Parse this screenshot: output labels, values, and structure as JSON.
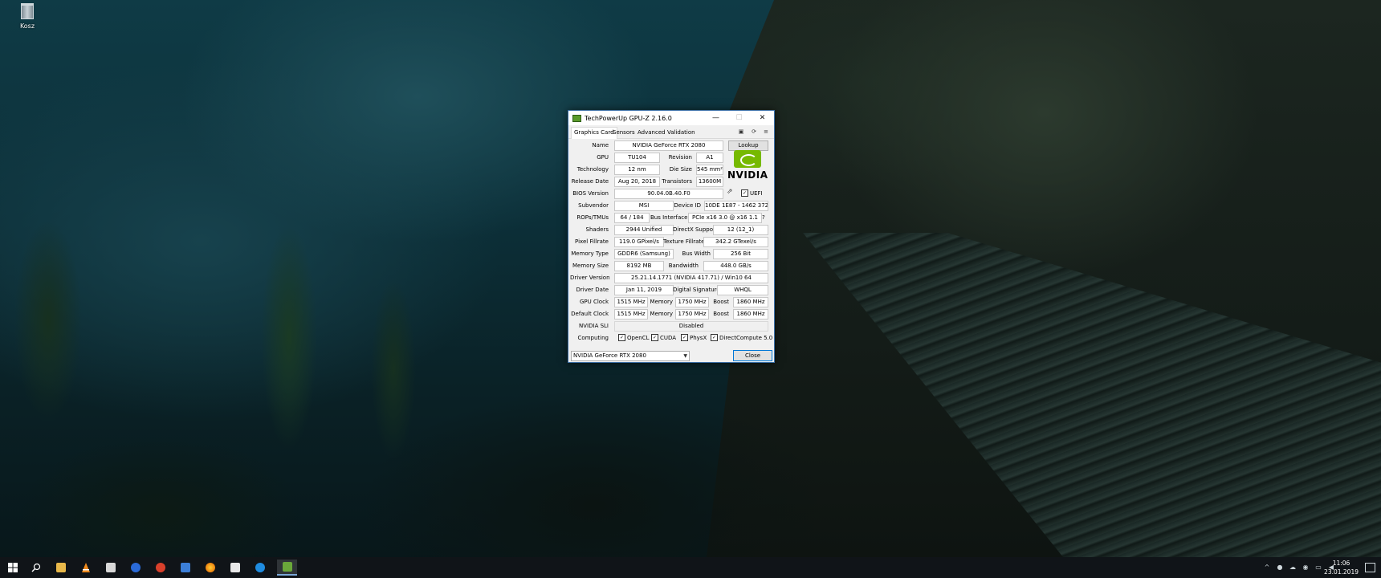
{
  "desktop": {
    "icons": [
      {
        "label": "Kosz",
        "icon": "recycle-bin-icon"
      }
    ]
  },
  "window": {
    "title": "TechPowerUp GPU-Z 2.16.0",
    "controls": {
      "minimize": "—",
      "maximize": "☐",
      "close": "✕"
    },
    "tabs": [
      "Graphics Card",
      "Sensors",
      "Advanced",
      "Validation"
    ],
    "active_tab": "Graphics Card",
    "tool_icons": [
      "camera-icon",
      "refresh-icon",
      "menu-icon"
    ]
  },
  "card": {
    "name_label": "Name",
    "name": "NVIDIA GeForce RTX 2080",
    "lookup": "Lookup",
    "gpu_label": "GPU",
    "gpu": "TU104",
    "revision_label": "Revision",
    "revision": "A1",
    "technology_label": "Technology",
    "technology": "12 nm",
    "die_size_label": "Die Size",
    "die_size": "545 mm²",
    "release_label": "Release Date",
    "release": "Aug 20, 2018",
    "transistors_label": "Transistors",
    "transistors": "13600M",
    "bios_label": "BIOS Version",
    "bios": "90.04.0B.40.F0",
    "uefi_label": "UEFI",
    "subvendor_label": "Subvendor",
    "subvendor": "MSI",
    "device_id_label": "Device ID",
    "device_id": "10DE 1E87 - 1462 3726",
    "rops_label": "ROPs/TMUs",
    "rops": "64 / 184",
    "bus_label": "Bus Interface",
    "bus": "PCIe x16 3.0 @ x16 1.1",
    "bus_help": "?",
    "shaders_label": "Shaders",
    "shaders": "2944 Unified",
    "directx_label": "DirectX Support",
    "directx": "12 (12_1)",
    "pixel_label": "Pixel Fillrate",
    "pixel": "119.0 GPixel/s",
    "texture_label": "Texture Fillrate",
    "texture": "342.2 GTexel/s",
    "memtype_label": "Memory Type",
    "memtype": "GDDR6 (Samsung)",
    "buswidth_label": "Bus Width",
    "buswidth": "256 Bit",
    "memsize_label": "Memory Size",
    "memsize": "8192 MB",
    "bandwidth_label": "Bandwidth",
    "bandwidth": "448.0 GB/s",
    "driver_label": "Driver Version",
    "driver": "25.21.14.1771 (NVIDIA 417.71) / Win10 64",
    "driverdate_label": "Driver Date",
    "driverdate": "Jan 11, 2019",
    "digsig_label": "Digital Signature",
    "digsig": "WHQL",
    "gpuclock_label": "GPU Clock",
    "gpuclock": "1515 MHz",
    "memory_label": "Memory",
    "memclock": "1750 MHz",
    "boost_label": "Boost",
    "boost": "1860 MHz",
    "defclock_label": "Default Clock",
    "defclock": "1515 MHz",
    "defmem": "1750 MHz",
    "defboost": "1860 MHz",
    "sli_label": "NVIDIA SLI",
    "sli": "Disabled",
    "computing_label": "Computing",
    "computing": [
      "OpenCL",
      "CUDA",
      "PhysX",
      "DirectCompute 5.0"
    ],
    "vendor_logo_text": "NVIDIA"
  },
  "footer": {
    "selected_gpu": "NVIDIA GeForce RTX 2080",
    "close": "Close"
  },
  "taskbar": {
    "apps": [
      "start-icon",
      "search-icon",
      "file-explorer-icon",
      "vlc-icon",
      "film-icon",
      "malwarebytes-icon",
      "ccleaner-icon",
      "save-icon",
      "firefox-icon",
      "mail-icon",
      "edge-icon",
      "gpuz-icon"
    ],
    "active_app": "gpuz-icon",
    "time": "11:06",
    "date": "23.01.2019"
  },
  "colors": {
    "nvidia_green": "#76b900",
    "taskbar": "#101418",
    "title_border": "#3b6ea5"
  }
}
